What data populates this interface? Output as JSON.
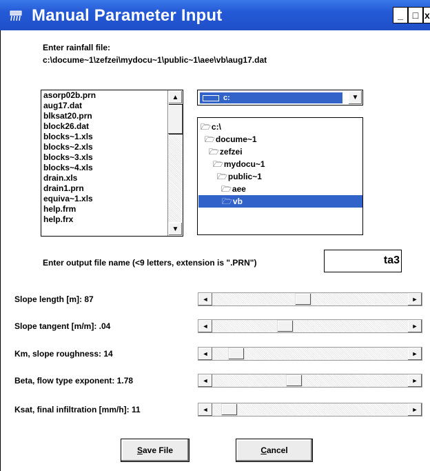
{
  "window": {
    "title": "Manual Parameter Input",
    "minimize_label": "_",
    "maximize_label": "□",
    "close_label": "x",
    "titlebar_color": "#2459d6",
    "selection_color": "#3163c9"
  },
  "rainfall": {
    "prompt": "Enter rainfall file:",
    "path": "c:\\docume~1\\zefzei\\mydocu~1\\public~1\\aee\\vb\\aug17.dat"
  },
  "file_list": {
    "items": [
      "asorp02b.prn",
      "aug17.dat",
      "blksat20.prn",
      "block26.dat",
      "blocks~1.xls",
      "blocks~2.xls",
      "blocks~3.xls",
      "blocks~4.xls",
      "drain.xls",
      "drain1.prn",
      "equiva~1.xls",
      "help.frm",
      "help.frx"
    ],
    "scroll_up_icon": "▲",
    "scroll_down_icon": "▼"
  },
  "drive": {
    "selected": "c:",
    "dropdown_icon": "▼"
  },
  "dir_list": {
    "items": [
      "c:\\",
      "docume~1",
      "zefzei",
      "mydocu~1",
      "public~1",
      "aee",
      "vb"
    ],
    "selected": "vb"
  },
  "output": {
    "prompt": "Enter output file name (<9 letters, extension is \".PRN\")",
    "value": "ta3"
  },
  "params": [
    {
      "label": "Slope length [m]: 87",
      "position": 0.46
    },
    {
      "label": "Slope tangent [m/m]: .04",
      "position": 0.36
    },
    {
      "label": "Km, slope roughness: 14",
      "position": 0.09
    },
    {
      "label": "Beta, flow type exponent: 1.78",
      "position": 0.41
    },
    {
      "label": "Ksat, final infiltration [mm/h]: 11",
      "position": 0.05
    }
  ],
  "scroll_left_icon": "◄",
  "scroll_right_icon": "►",
  "buttons": {
    "save_label": "ave File",
    "save_mnemonic": "S",
    "cancel_label": "ancel",
    "cancel_mnemonic": "C"
  }
}
